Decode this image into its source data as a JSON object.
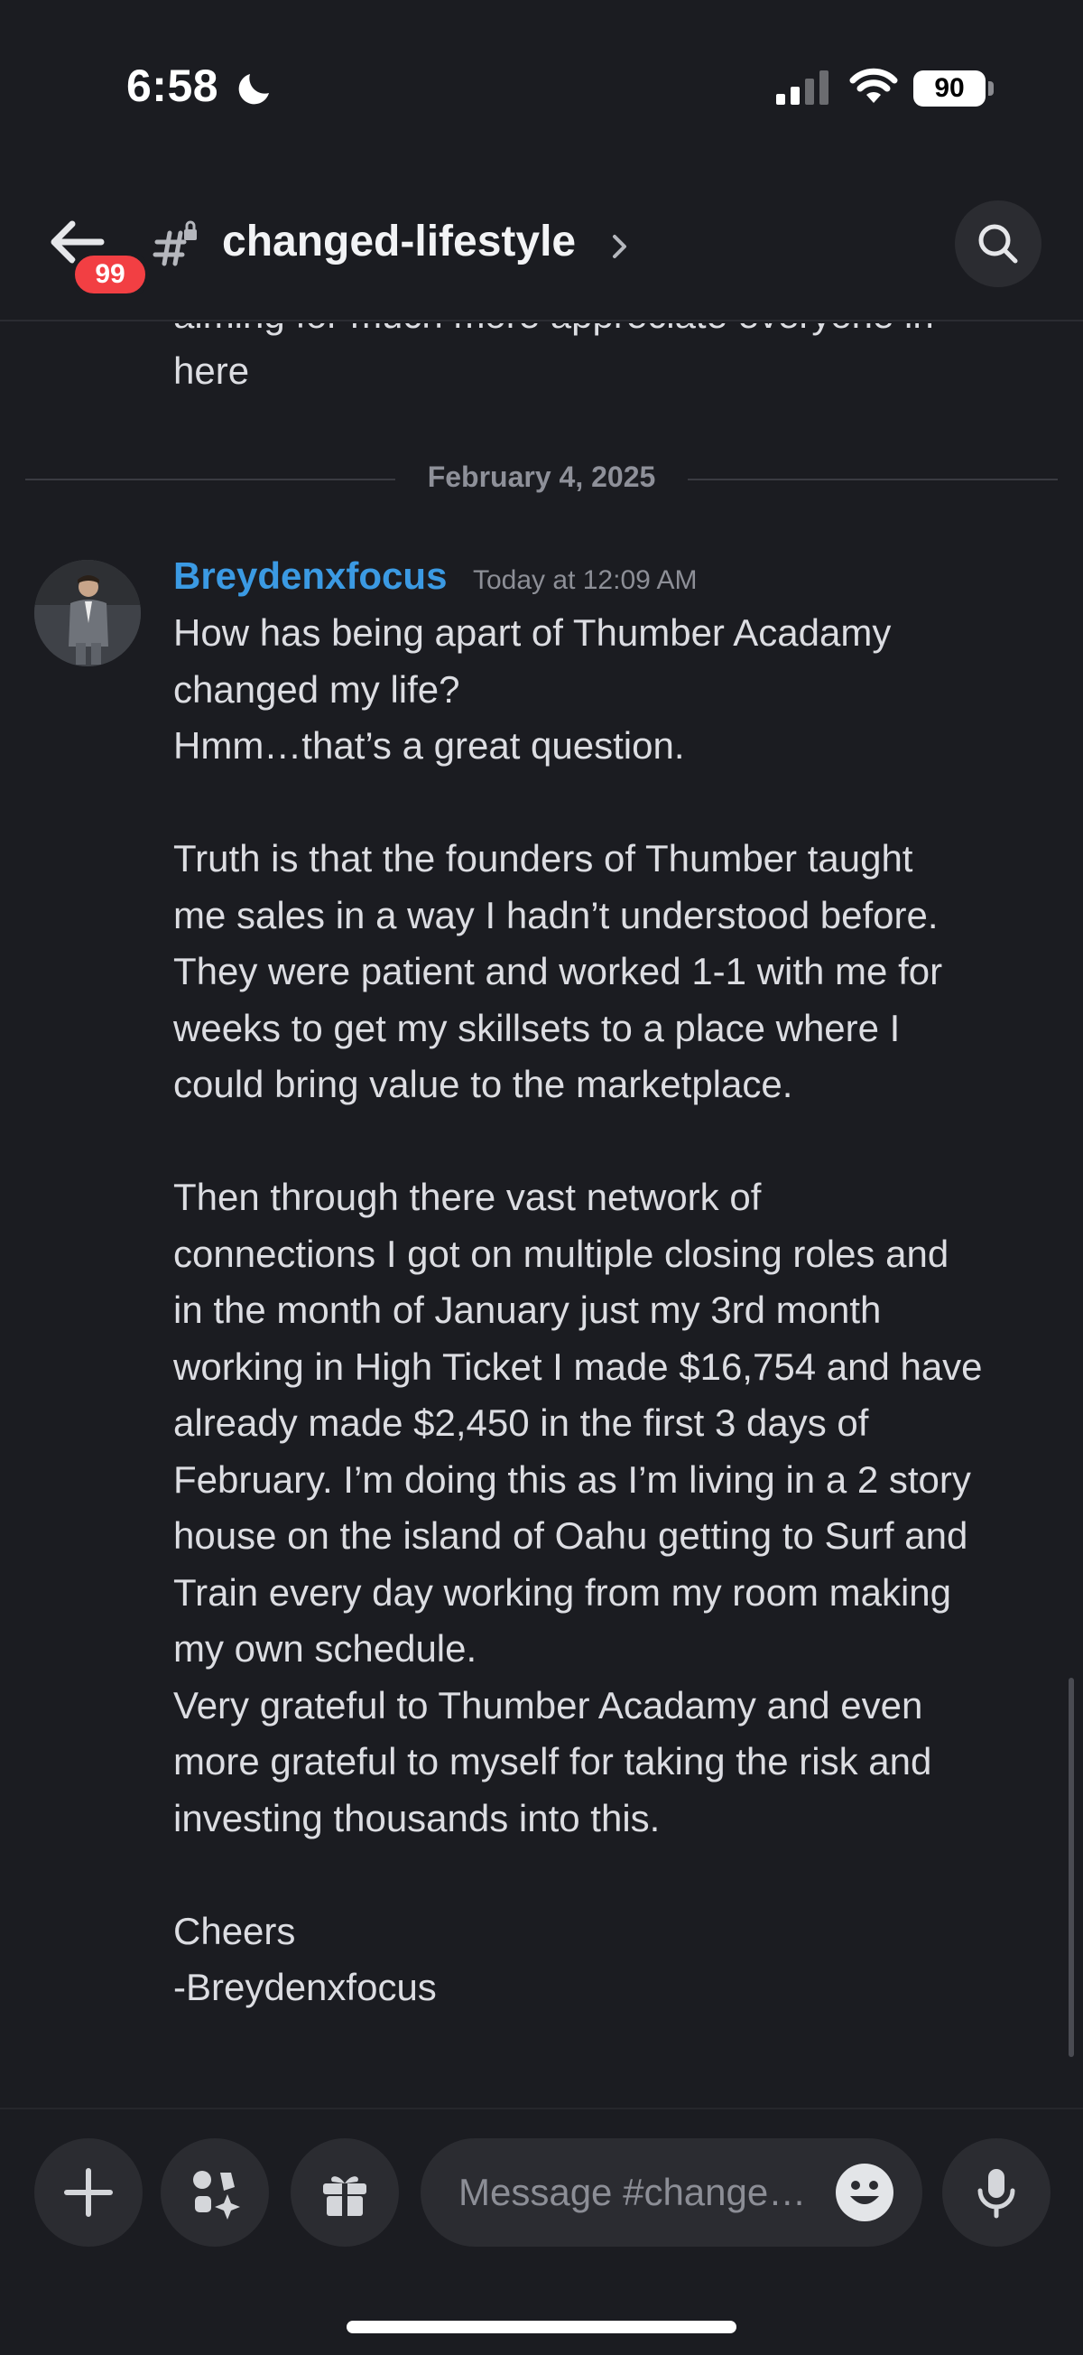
{
  "status": {
    "time": "6:58",
    "battery": "90"
  },
  "header": {
    "unread_count": "99",
    "channel_name": "changed-lifestyle"
  },
  "chat": {
    "previous_message_tail": "aiming for much more appreciate everyone in\nhere",
    "date_divider": "February 4, 2025",
    "message": {
      "author": "Breydenxfocus",
      "timestamp": "Today at 12:09 AM",
      "body": "How has being apart of Thumber Acadamy\nchanged my life?\nHmm…that’s a great question.\n\nTruth is that the founders of Thumber taught\nme sales in a way I hadn’t understood before.\nThey were patient and worked 1-1 with me for\nweeks to get my skillsets to a place where I\ncould bring value to the marketplace.\n\nThen through there vast network of\nconnections I got on multiple closing roles and\nin the month of January just my 3rd month\nworking in High Ticket I made $16,754 and have\nalready made $2,450 in the first 3 days of\nFebruary. I’m doing this as I’m living in a 2 story\nhouse on the island of Oahu getting to Surf and\nTrain every day working from my room making\nmy own schedule.\nVery grateful to Thumber Acadamy and even\nmore grateful to myself for taking the risk and\ninvesting thousands into this.\n\nCheers\n-Breydenxfocus"
    }
  },
  "composer": {
    "placeholder": "Message #change…"
  },
  "colors": {
    "username": "#3b9ae3",
    "badge": "#f23f43",
    "background": "#1b1c21"
  }
}
